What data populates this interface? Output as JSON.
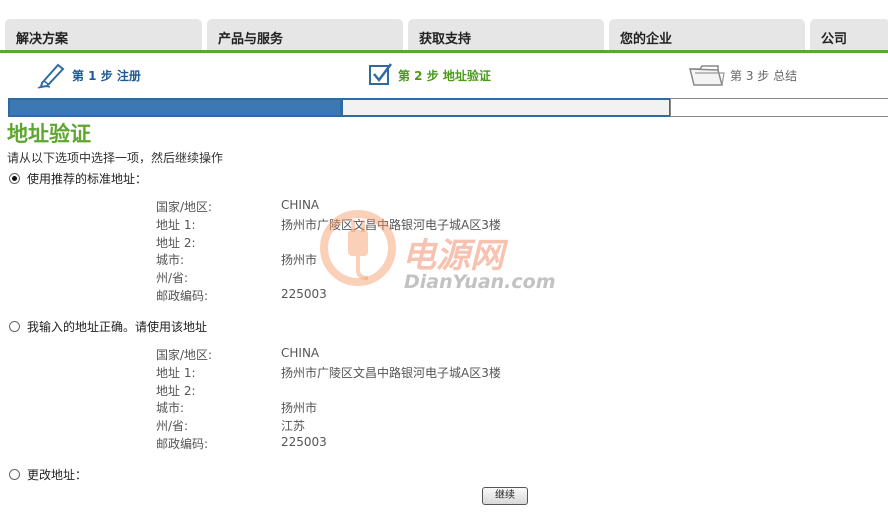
{
  "nav": {
    "tabs": [
      {
        "label": "解决方案"
      },
      {
        "label": "产品与服务"
      },
      {
        "label": "获取支持"
      },
      {
        "label": "您的企业"
      },
      {
        "label": "公司"
      }
    ]
  },
  "steps": [
    {
      "label": "第 1 步 注册",
      "icon": "pen-icon"
    },
    {
      "label": "第 2 步 地址验证",
      "icon": "checkbox-icon"
    },
    {
      "label": "第 3 步 总结",
      "icon": "folder-icon"
    }
  ],
  "progress": {
    "completed_steps": 1,
    "current_step": 2,
    "total_steps": 3
  },
  "page": {
    "title": "地址验证",
    "instruction": "请从以下选项中选择一项，然后继续操作"
  },
  "options": {
    "recommended": {
      "label": "使用推荐的标准地址：",
      "selected": true,
      "fields": [
        {
          "key": "国家/地区:",
          "value": "CHINA"
        },
        {
          "key": "地址 1:",
          "value": "扬州市广陵区文昌中路银河电子城A区3楼"
        },
        {
          "key": "地址 2:",
          "value": ""
        },
        {
          "key": "城市:",
          "value": "扬州市"
        },
        {
          "key": "州/省:",
          "value": ""
        },
        {
          "key": "邮政编码:",
          "value": "225003"
        }
      ]
    },
    "entered": {
      "label": "我输入的地址正确。请使用该地址",
      "selected": false,
      "fields": [
        {
          "key": "国家/地区:",
          "value": "CHINA"
        },
        {
          "key": "地址 1:",
          "value": "扬州市广陵区文昌中路银河电子城A区3楼"
        },
        {
          "key": "地址 2:",
          "value": ""
        },
        {
          "key": "城市:",
          "value": "扬州市"
        },
        {
          "key": "州/省:",
          "value": "江苏"
        },
        {
          "key": "邮政编码:",
          "value": "225003"
        }
      ]
    },
    "change": {
      "label": "更改地址：",
      "selected": false
    }
  },
  "continue_button": "继续",
  "watermark": {
    "cn": "电源网",
    "en": "DianYuan.com"
  },
  "colors": {
    "accent_green": "#5fa630",
    "progress_blue": "#3b79b6",
    "step_blue": "#1f5b93"
  }
}
